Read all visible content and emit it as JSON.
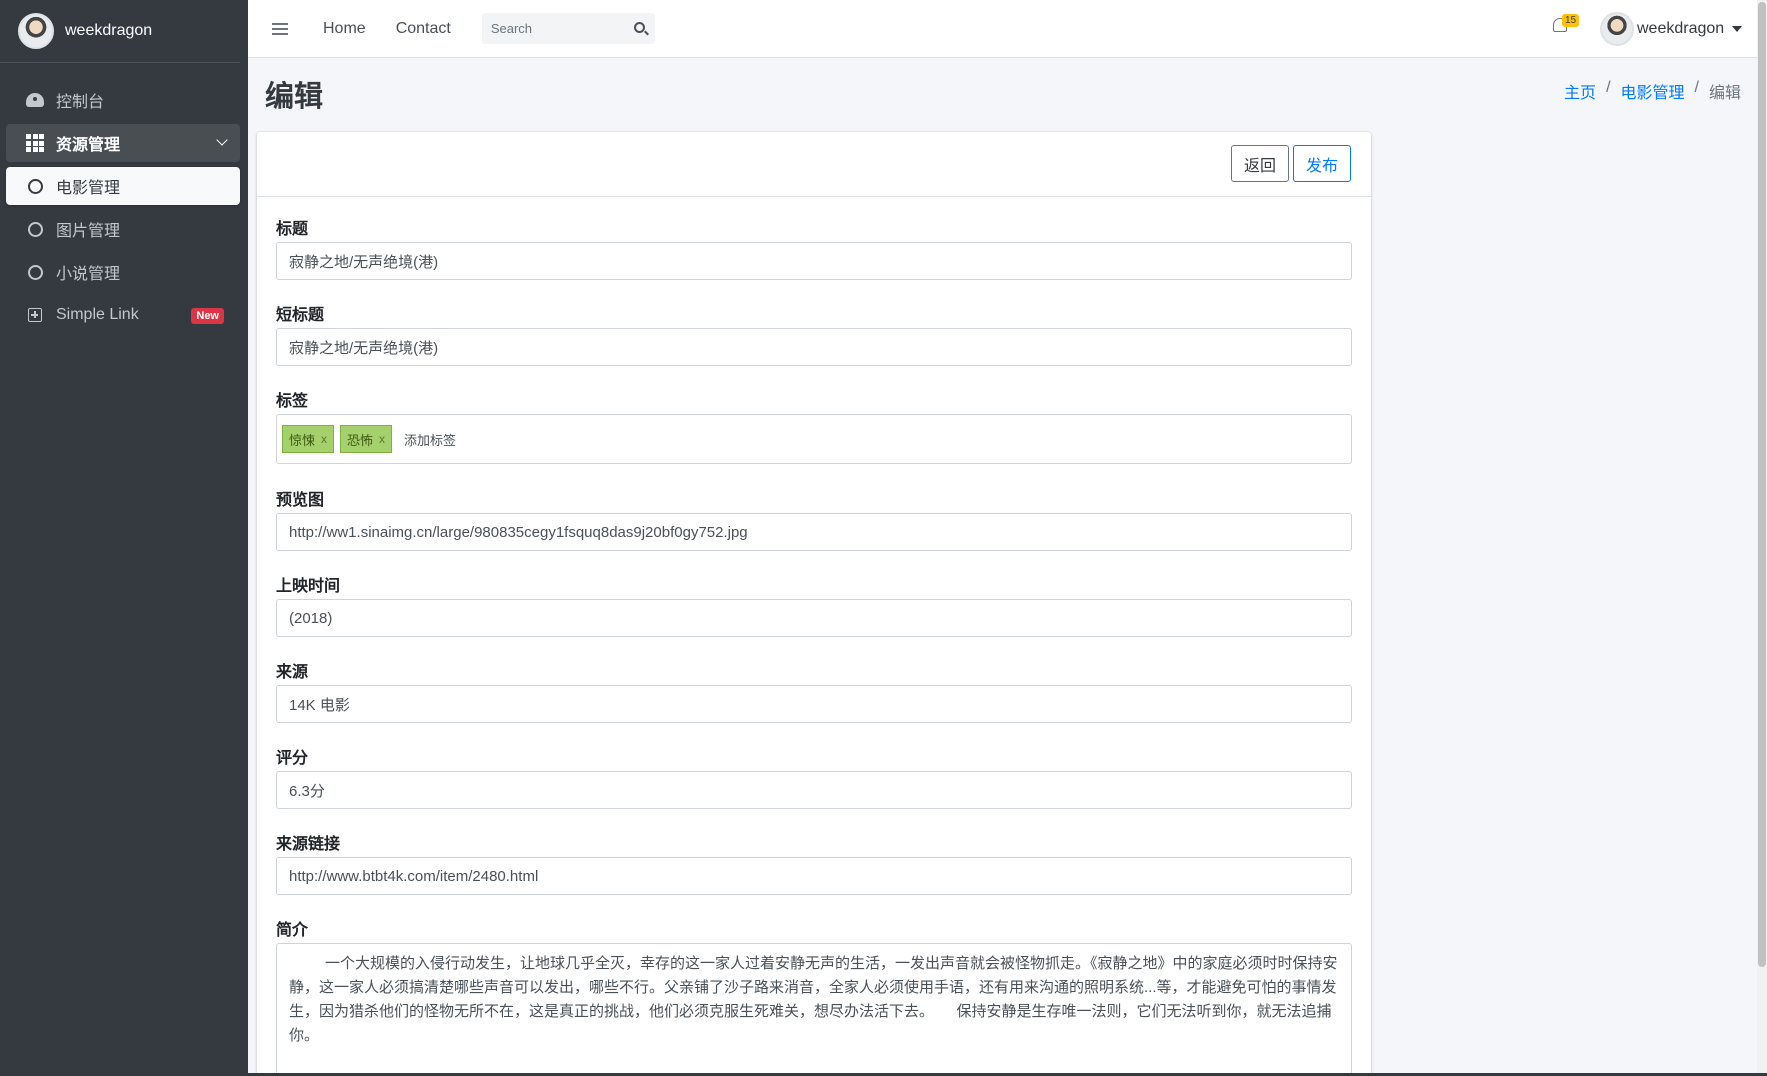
{
  "brand": {
    "name": "weekdragon"
  },
  "sidebar": {
    "items": [
      {
        "label": "控制台",
        "icon": "dashboard-icon"
      },
      {
        "label": "资源管理",
        "icon": "grid-icon"
      },
      {
        "label": "电影管理",
        "icon": "circle-icon"
      },
      {
        "label": "图片管理",
        "icon": "circle-icon"
      },
      {
        "label": "小说管理",
        "icon": "circle-icon"
      },
      {
        "label": "Simple Link",
        "icon": "plus-square-icon",
        "badge": "New"
      }
    ]
  },
  "topbar": {
    "links": [
      "Home",
      "Contact"
    ],
    "search_placeholder": "Search",
    "notification_count": "15",
    "user_name": "weekdragon"
  },
  "page": {
    "title": "编辑",
    "breadcrumb": [
      "主页",
      "电影管理",
      "编辑"
    ]
  },
  "card": {
    "back_label": "返回",
    "publish_label": "发布"
  },
  "form": {
    "title_label": "标题",
    "title_value": "寂静之地/无声绝境(港)",
    "short_title_label": "短标题",
    "short_title_value": "寂静之地/无声绝境(港)",
    "tags_label": "标签",
    "tags": [
      "惊悚",
      "恐怖"
    ],
    "tag_remove": "x",
    "tag_placeholder": "添加标签",
    "preview_label": "预览图",
    "preview_value": "http://ww1.sinaimg.cn/large/980835cegy1fsquq8das9j20bf0gy752.jpg",
    "release_label": "上映时间",
    "release_value": "(2018)",
    "source_label": "来源",
    "source_value": "14K 电影",
    "rating_label": "评分",
    "rating_value": "6.3分",
    "source_link_label": "来源链接",
    "source_link_value": "http://www.btbt4k.com/item/2480.html",
    "intro_label": "简介",
    "intro_value": "一个大规模的入侵行动发生，让地球几乎全灭，幸存的这一家人过着安静无声的生活，一发出声音就会被怪物抓走。《寂静之地》中的家庭必须时时保持安静，这一家人必须搞清楚哪些声音可以发出，哪些不行。父亲铺了沙子路来消音，全家人必须使用手语，还有用来沟通的照明系统...等，才能避免可怕的事情发生，因为猎杀他们的怪物无所不在，这是真正的挑战，他们必须克服生死难关，想尽办法活下去。　　保持安静是生存唯一法则，它们无法听到你，就无法追捕你。"
  },
  "colors": {
    "sidebar_bg": "#343a40",
    "primary": "#007bff",
    "tag_bg": "#a5d16c",
    "badge_red": "#dc3545",
    "badge_yellow": "#ffc107"
  }
}
